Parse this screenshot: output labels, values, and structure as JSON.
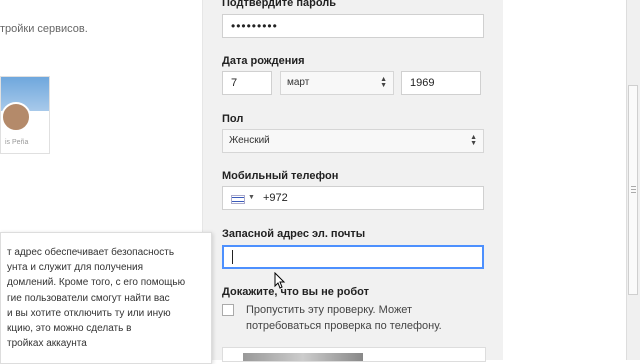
{
  "left": {
    "intro_fragment": "тройки сервисов.",
    "profile_name": "is Peña"
  },
  "form": {
    "confirm_password": {
      "label": "Подтвердите пароль",
      "value": "•••••••••"
    },
    "birthdate": {
      "label": "Дата рождения",
      "day": "7",
      "month": "март",
      "year": "1969"
    },
    "gender": {
      "label": "Пол",
      "value": "Женский"
    },
    "phone": {
      "label": "Мобильный телефон",
      "country_code": "+972"
    },
    "backup_email": {
      "label": "Запасной адрес эл. почты",
      "value": ""
    },
    "captcha": {
      "label": "Докажите, что вы не робот",
      "skip_text_line1": "Пропустить эту проверку. Может",
      "skip_text_line2": "потребоваться проверка по телефону."
    }
  },
  "tooltip": {
    "lines": [
      "т адрес обеспечивает безопасность",
      "унта и служит для получения",
      "домлений. Кроме того, с его помощью",
      "гие пользователи смогут найти вас",
      "и вы хотите отключить ту или иную",
      "кцию, это можно сделать в",
      "тройках аккаунта"
    ]
  },
  "colors": {
    "focus": "#4d90fe",
    "panel_bg": "#f1f1f1"
  }
}
